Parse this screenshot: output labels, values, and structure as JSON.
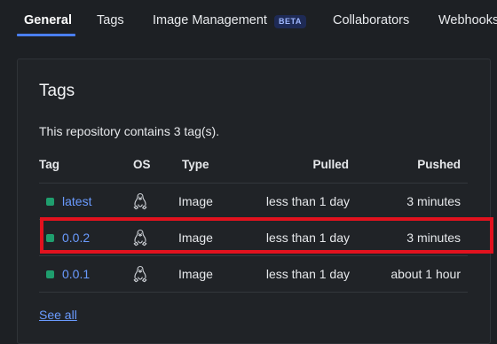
{
  "tabs": [
    {
      "label": "General",
      "active": true
    },
    {
      "label": "Tags"
    },
    {
      "label": "Image Management",
      "badge": "BETA"
    },
    {
      "label": "Collaborators"
    },
    {
      "label": "Webhooks"
    }
  ],
  "card": {
    "title": "Tags",
    "description": "This repository contains 3 tag(s).",
    "columns": [
      "Tag",
      "OS",
      "Type",
      "Pulled",
      "Pushed"
    ],
    "rows": [
      {
        "tag": "latest",
        "os_icon": "linux-icon",
        "type": "Image",
        "pulled": "less than 1 day",
        "pushed": "3 minutes"
      },
      {
        "tag": "0.0.2",
        "os_icon": "linux-icon",
        "type": "Image",
        "pulled": "less than 1 day",
        "pushed": "3 minutes"
      },
      {
        "tag": "0.0.1",
        "os_icon": "linux-icon",
        "type": "Image",
        "pulled": "less than 1 day",
        "pushed": "about 1 hour"
      }
    ],
    "see_all": "See all"
  },
  "colors": {
    "background": "#1d2024",
    "accent": "#4a7ff0",
    "link": "#6a9bff",
    "status_dot": "#1f9e6e",
    "highlight": "#e2121e"
  }
}
